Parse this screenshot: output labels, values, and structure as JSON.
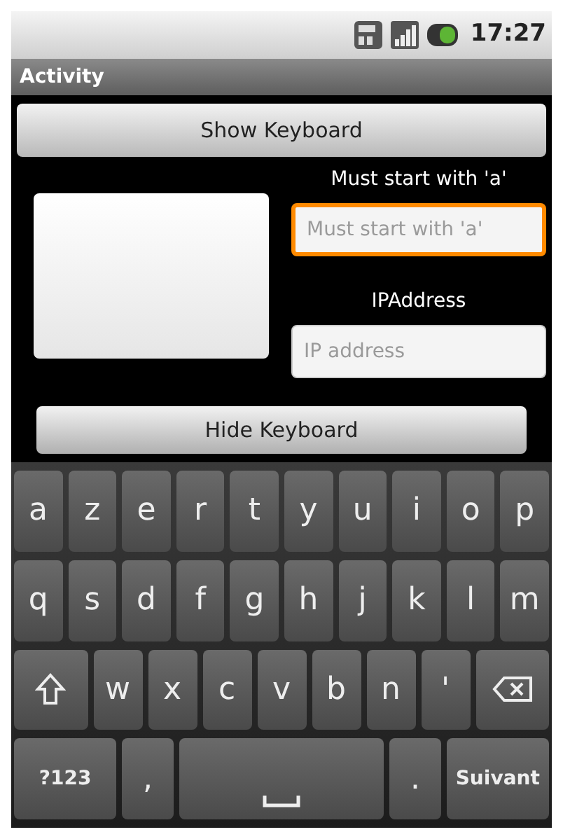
{
  "status_bar": {
    "time": "17:27"
  },
  "title_bar": {
    "title": "Activity"
  },
  "show_button": {
    "label": "Show Keyboard"
  },
  "fields": [
    {
      "label": "Must start with 'a'",
      "placeholder": "Must start with 'a'",
      "focused": true
    },
    {
      "label": "IPAddress",
      "placeholder": "IP address",
      "focused": false
    }
  ],
  "hide_button": {
    "label": "Hide Keyboard"
  },
  "keyboard": {
    "rows": [
      {
        "keys": [
          {
            "kind": "char",
            "label": "a"
          },
          {
            "kind": "char",
            "label": "z"
          },
          {
            "kind": "char",
            "label": "e"
          },
          {
            "kind": "char",
            "label": "r"
          },
          {
            "kind": "char",
            "label": "t"
          },
          {
            "kind": "char",
            "label": "y"
          },
          {
            "kind": "char",
            "label": "u"
          },
          {
            "kind": "char",
            "label": "i"
          },
          {
            "kind": "char",
            "label": "o"
          },
          {
            "kind": "char",
            "label": "p"
          }
        ]
      },
      {
        "keys": [
          {
            "kind": "char",
            "label": "q"
          },
          {
            "kind": "char",
            "label": "s"
          },
          {
            "kind": "char",
            "label": "d"
          },
          {
            "kind": "char",
            "label": "f"
          },
          {
            "kind": "char",
            "label": "g"
          },
          {
            "kind": "char",
            "label": "h"
          },
          {
            "kind": "char",
            "label": "j"
          },
          {
            "kind": "char",
            "label": "k"
          },
          {
            "kind": "char",
            "label": "l"
          },
          {
            "kind": "char",
            "label": "m"
          }
        ]
      },
      {
        "keys": [
          {
            "kind": "shift"
          },
          {
            "kind": "char",
            "label": "w"
          },
          {
            "kind": "char",
            "label": "x"
          },
          {
            "kind": "char",
            "label": "c"
          },
          {
            "kind": "char",
            "label": "v"
          },
          {
            "kind": "char",
            "label": "b"
          },
          {
            "kind": "char",
            "label": "n"
          },
          {
            "kind": "char",
            "label": "'"
          },
          {
            "kind": "backspace"
          }
        ]
      },
      {
        "keys": [
          {
            "kind": "mode",
            "label": "?123"
          },
          {
            "kind": "char",
            "label": ","
          },
          {
            "kind": "space"
          },
          {
            "kind": "char",
            "label": "."
          },
          {
            "kind": "action",
            "label": "Suivant"
          }
        ]
      }
    ]
  }
}
